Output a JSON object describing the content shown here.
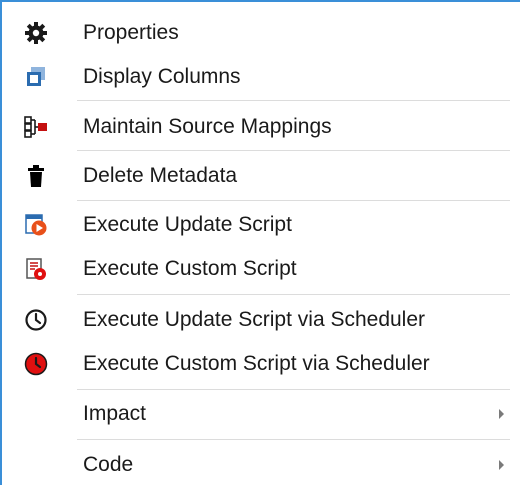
{
  "menu": {
    "items": [
      {
        "label": "Properties",
        "icon": "gear-icon"
      },
      {
        "label": "Display Columns",
        "icon": "display-columns-icon"
      },
      {
        "label": "Maintain Source Mappings",
        "icon": "source-mappings-icon"
      },
      {
        "label": "Delete Metadata",
        "icon": "trash-icon"
      },
      {
        "label": "Execute Update Script",
        "icon": "execute-update-script-icon"
      },
      {
        "label": "Execute Custom Script",
        "icon": "execute-custom-script-icon"
      },
      {
        "label": "Execute Update Script via Scheduler",
        "icon": "clock-icon"
      },
      {
        "label": "Execute Custom Script via Scheduler",
        "icon": "red-clock-icon"
      },
      {
        "label": "Impact",
        "has_submenu": true
      },
      {
        "label": "Code",
        "has_submenu": true
      }
    ]
  },
  "colors": {
    "border": "#3a8fd8",
    "separator": "#dcdcdc",
    "icon_blue": "#2b6cb0",
    "icon_red": "#e01010",
    "icon_orange": "#e8501a",
    "text": "#1a1a1a"
  }
}
